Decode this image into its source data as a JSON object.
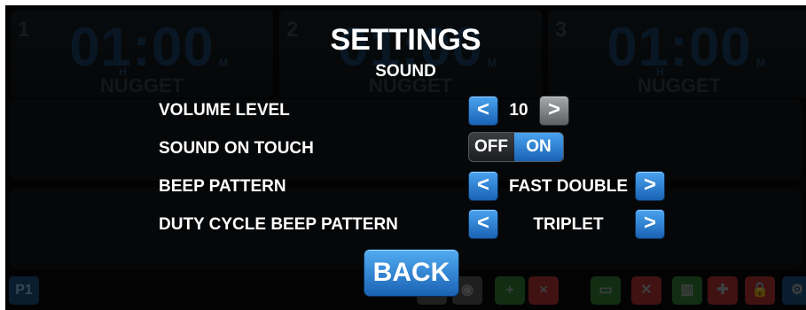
{
  "background": {
    "tiles": [
      {
        "number": "1",
        "time": "01:00",
        "h": "H",
        "m": "M",
        "name": "NUGGET"
      },
      {
        "number": "2",
        "time": "01:00",
        "h": "H",
        "m": "M",
        "name": "NUGGET"
      },
      {
        "number": "3",
        "time": "01:00",
        "h": "H",
        "m": "M",
        "name": "NUGGET"
      }
    ],
    "profile_button": "P1"
  },
  "dialog": {
    "title": "SETTINGS",
    "subtitle": "SOUND",
    "rows": [
      {
        "label": "VOLUME LEVEL",
        "value": "10",
        "prev": "<",
        "next": ">"
      },
      {
        "label": "SOUND ON TOUCH",
        "off": "OFF",
        "on": "ON",
        "selected": "ON"
      },
      {
        "label": "BEEP PATTERN",
        "value": "FAST DOUBLE",
        "prev": "<",
        "next": ">"
      },
      {
        "label": "DUTY CYCLE BEEP PATTERN",
        "value": "TRIPLET",
        "prev": "<",
        "next": ">"
      }
    ],
    "back_label": "BACK"
  },
  "colors": {
    "accent": "#2a7fd4",
    "disabled": "#7a7d80",
    "background": "#050607"
  }
}
